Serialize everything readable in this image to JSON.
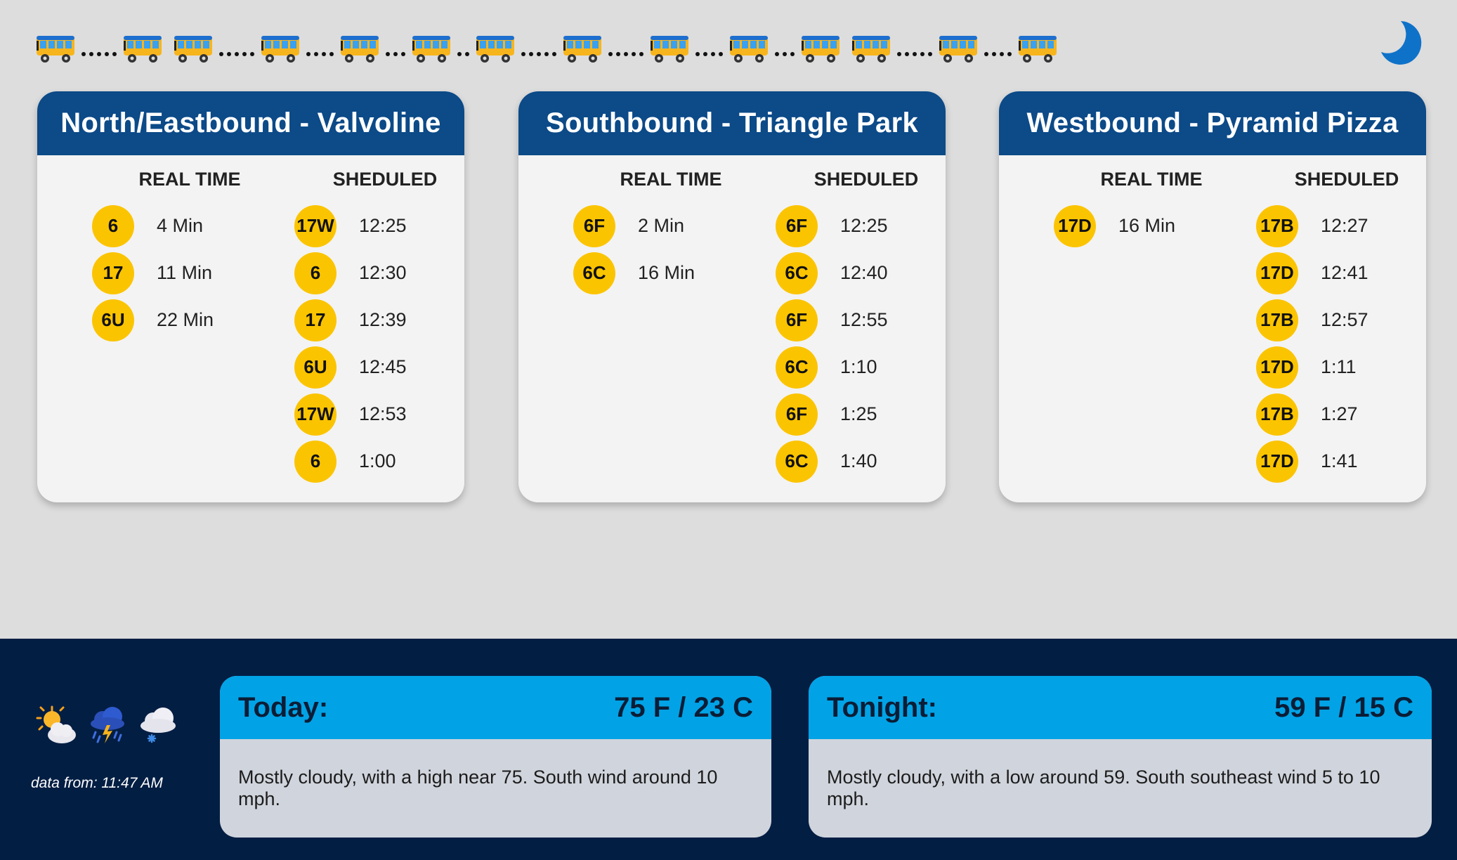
{
  "ticker": {
    "pattern": [
      5,
      0,
      5,
      4,
      3,
      2,
      5,
      5,
      4,
      3,
      0,
      5,
      4,
      0
    ]
  },
  "stops": [
    {
      "title": "North/Eastbound - Valvoline",
      "realtime_label": "REAL TIME",
      "scheduled_label": "SHEDULED",
      "realtime": [
        {
          "route": "6",
          "eta": "4 Min"
        },
        {
          "route": "17",
          "eta": "11 Min"
        },
        {
          "route": "6U",
          "eta": "22 Min"
        }
      ],
      "scheduled": [
        {
          "route": "17W",
          "time": "12:25"
        },
        {
          "route": "6",
          "time": "12:30"
        },
        {
          "route": "17",
          "time": "12:39"
        },
        {
          "route": "6U",
          "time": "12:45"
        },
        {
          "route": "17W",
          "time": "12:53"
        },
        {
          "route": "6",
          "time": "1:00"
        }
      ]
    },
    {
      "title": "Southbound - Triangle Park",
      "realtime_label": "REAL TIME",
      "scheduled_label": "SHEDULED",
      "realtime": [
        {
          "route": "6F",
          "eta": "2 Min"
        },
        {
          "route": "6C",
          "eta": "16 Min"
        }
      ],
      "scheduled": [
        {
          "route": "6F",
          "time": "12:25"
        },
        {
          "route": "6C",
          "time": "12:40"
        },
        {
          "route": "6F",
          "time": "12:55"
        },
        {
          "route": "6C",
          "time": "1:10"
        },
        {
          "route": "6F",
          "time": "1:25"
        },
        {
          "route": "6C",
          "time": "1:40"
        }
      ]
    },
    {
      "title": "Westbound - Pyramid Pizza",
      "realtime_label": "REAL TIME",
      "scheduled_label": "SHEDULED",
      "realtime": [
        {
          "route": "17D",
          "eta": "16 Min"
        }
      ],
      "scheduled": [
        {
          "route": "17B",
          "time": "12:27"
        },
        {
          "route": "17D",
          "time": "12:41"
        },
        {
          "route": "17B",
          "time": "12:57"
        },
        {
          "route": "17D",
          "time": "1:11"
        },
        {
          "route": "17B",
          "time": "1:27"
        },
        {
          "route": "17D",
          "time": "1:41"
        }
      ]
    }
  ],
  "weather": {
    "icons": [
      "partly-cloudy-sun-icon",
      "thunderstorm-rain-icon",
      "snow-cloud-icon"
    ],
    "data_from": "data from: 11:47 AM",
    "today": {
      "label": "Today:",
      "temp": "75 F / 23 C",
      "forecast": "Mostly cloudy, with a high near 75. South wind around 10 mph."
    },
    "tonight": {
      "label": "Tonight:",
      "temp": "59 F / 15 C",
      "forecast": "Mostly cloudy, with a low around 59. South southeast wind 5 to 10 mph."
    }
  },
  "colors": {
    "header_blue": "#0c4a88",
    "badge_yellow": "#fbc400",
    "band_navy": "#031e43",
    "weather_head": "#01a3e6"
  }
}
